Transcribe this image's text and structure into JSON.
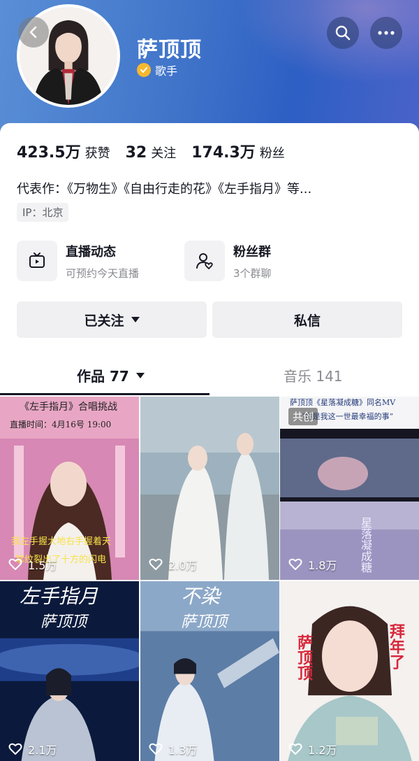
{
  "profile": {
    "name": "萨顶顶",
    "verified_label": "歌手"
  },
  "stats": [
    {
      "value": "423.5万",
      "label": "获赞"
    },
    {
      "value": "32",
      "label": "关注"
    },
    {
      "value": "174.3万",
      "label": "粉丝"
    }
  ],
  "bio": "代表作：《万物生》《自由行走的花》《左手指月》等...",
  "ip_label": "IP：北京",
  "features": {
    "live": {
      "title": "直播动态",
      "subtitle": "可预约今天直播",
      "icon": "tv-icon"
    },
    "fans": {
      "title": "粉丝群",
      "subtitle": "3个群聊",
      "icon": "fan-group-icon"
    }
  },
  "actions": {
    "follow_label": "已关注",
    "message_label": "私信"
  },
  "tabs": [
    {
      "label": "作品 77",
      "active": true
    },
    {
      "label": "音乐 141",
      "active": false
    }
  ],
  "videos": [
    {
      "likes": "1.5万",
      "caption_lines": [
        "《左手指月》合唱挑战",
        "直播时间：4月16号 19:00"
      ],
      "subtitle_lines": [
        "我左手握大地右手握着天",
        "掌纹裂出了十方的闪电"
      ]
    },
    {
      "likes": "2.0万"
    },
    {
      "likes": "1.8万",
      "badge": "共创",
      "caption_lines": [
        "萨顶顶《星落凝成糖》同名MV",
        "“你是我这一世最幸福的事”"
      ],
      "art_text": "星落凝成糖"
    },
    {
      "likes": "2.1万",
      "caption_lines": [
        "左手指月",
        "萨顶顶"
      ]
    },
    {
      "likes": "1.3万",
      "caption_lines": [
        "不染",
        "萨顶顶"
      ]
    },
    {
      "likes": "1.2万",
      "caption_lines": [
        "萨顶顶",
        "拜年了"
      ]
    }
  ],
  "colors": {
    "header_blue": "#3f73c9",
    "verify_gold": "#f5b82e",
    "text_primary": "#161823",
    "text_secondary": "#8a8b91"
  }
}
